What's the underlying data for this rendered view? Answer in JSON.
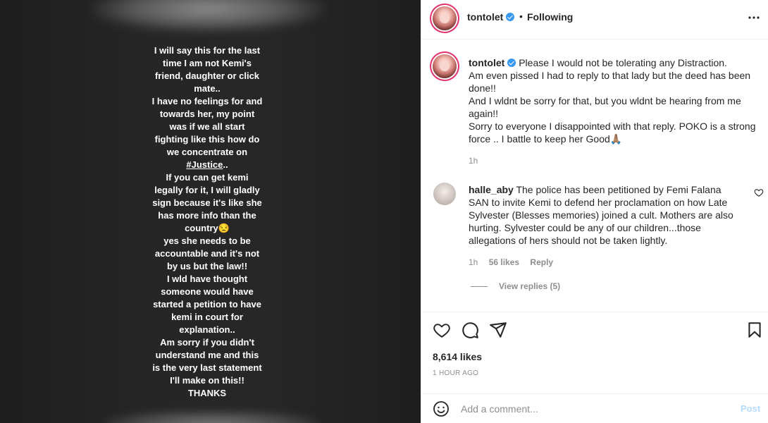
{
  "story": {
    "lines": [
      "I will say this for the last",
      "time I am not Kemi's",
      "friend, daughter or click",
      "mate..",
      "I have no feelings for and",
      "towards her, my point",
      "was if we all start",
      "fighting like this how do",
      "we concentrate on",
      "#Justice..",
      "If you can get kemi",
      "legally for it, I will gladly",
      "sign because it's like she",
      "has more info than the",
      "country😒",
      "yes she needs to be",
      "accountable and it's not",
      "by us but the law!!",
      "I wld have thought",
      "someone would have",
      "started a petition to have",
      "kemi in court for",
      "explanation..",
      "Am sorry if you didn't",
      "understand me and this",
      "is the very last statement",
      "I'll make on this!!",
      "THANKS"
    ]
  },
  "header": {
    "username": "tontolet",
    "separator": "•",
    "follow_label": "Following",
    "more_icon": "more-horizontal-icon"
  },
  "caption": {
    "username": "tontolet",
    "text": "Please I would not be tolerating any Distraction.\nAm even pissed I had to reply to that lady but the deed has been done!!\nAnd I wldnt be sorry for that, but you wldnt be hearing from me again!!\nSorry to everyone I disappointed with that reply. POKO is a strong force .. I battle to keep her Good🙏🏽",
    "time": "1h"
  },
  "comment": {
    "username": "halle_aby",
    "text": "The police has been petitioned by Femi Falana SAN to invite Kemi to defend her proclamation on how Late Sylvester (Blesses memories) joined a cult. Mothers are also hurting. Sylvester could be any of our children...those allegations of hers should not be taken lightly.",
    "time": "1h",
    "likes": "56 likes",
    "reply_label": "Reply",
    "view_replies": "View replies (5)"
  },
  "actions": {
    "likes": "8,614 likes",
    "post_time": "1 HOUR AGO",
    "comment_placeholder": "Add a comment...",
    "post_label": "Post"
  },
  "colors": {
    "verified": "#3897f0",
    "post_disabled": "#b3dbff",
    "muted": "#8e8e8e"
  }
}
